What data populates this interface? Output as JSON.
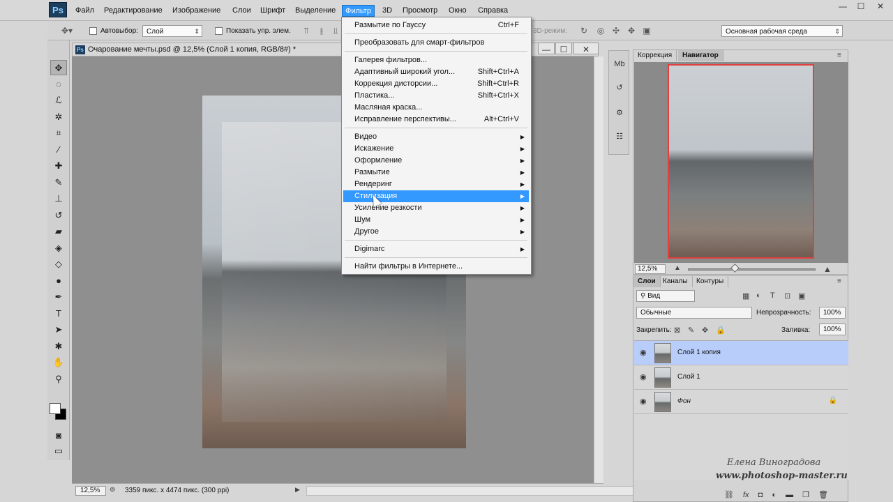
{
  "menubar": {
    "logo": "Ps",
    "items": [
      "Файл",
      "Редактирование",
      "Изображение",
      "Слои",
      "Шрифт",
      "Выделение",
      "Фильтр",
      "3D",
      "Просмотр",
      "Окно",
      "Справка"
    ],
    "active_index": 6,
    "window_controls": [
      "—",
      "☐",
      "✕"
    ]
  },
  "options": {
    "autoselect_label": "Автовыбор:",
    "autoselect_value": "Слой",
    "show_controls_label": "Показать упр. элем.",
    "mode3d_label": "3D-режим:",
    "workspace_value": "Основная рабочая среда"
  },
  "tools": [
    {
      "icon": "move-tool-icon",
      "glyph": "✥"
    },
    {
      "icon": "marquee-tool-icon",
      "glyph": "◌"
    },
    {
      "icon": "lasso-tool-icon",
      "glyph": "ℒ"
    },
    {
      "icon": "quick-select-tool-icon",
      "glyph": "✲"
    },
    {
      "icon": "crop-tool-icon",
      "glyph": "⌗"
    },
    {
      "icon": "eyedropper-tool-icon",
      "glyph": "⁄"
    },
    {
      "icon": "healing-brush-tool-icon",
      "glyph": "✚"
    },
    {
      "icon": "brush-tool-icon",
      "glyph": "✎"
    },
    {
      "icon": "clone-stamp-tool-icon",
      "glyph": "⊥"
    },
    {
      "icon": "history-brush-tool-icon",
      "glyph": "↺"
    },
    {
      "icon": "eraser-tool-icon",
      "glyph": "▰"
    },
    {
      "icon": "paint-bucket-tool-icon",
      "glyph": "◈"
    },
    {
      "icon": "blur-tool-icon",
      "glyph": "◇"
    },
    {
      "icon": "dodge-tool-icon",
      "glyph": "●"
    },
    {
      "icon": "pen-tool-icon",
      "glyph": "✒"
    },
    {
      "icon": "type-tool-icon",
      "glyph": "T"
    },
    {
      "icon": "path-select-tool-icon",
      "glyph": "➤"
    },
    {
      "icon": "shape-tool-icon",
      "glyph": "✱"
    },
    {
      "icon": "hand-tool-icon",
      "glyph": "✋"
    },
    {
      "icon": "zoom-tool-icon",
      "glyph": "⚲"
    }
  ],
  "document": {
    "title": "Очарование мечты.psd @ 12,5% (Слой 1 копия, RGB/8#) *",
    "controls": [
      "—",
      "☐",
      "✕"
    ],
    "status_zoom": "12,5%",
    "status_info": "3359 пикс. x 4474 пикс. (300 ppi)"
  },
  "filter_menu": {
    "items": [
      {
        "label": "Размытие по Гауссу",
        "shortcut": "Ctrl+F"
      },
      {
        "sep": true
      },
      {
        "label": "Преобразовать для смарт-фильтров"
      },
      {
        "sep": true
      },
      {
        "label": "Галерея фильтров..."
      },
      {
        "label": "Адаптивный широкий угол...",
        "shortcut": "Shift+Ctrl+A"
      },
      {
        "label": "Коррекция дисторсии...",
        "shortcut": "Shift+Ctrl+R"
      },
      {
        "label": "Пластика...",
        "shortcut": "Shift+Ctrl+X"
      },
      {
        "label": "Масляная краска..."
      },
      {
        "label": "Исправление перспективы...",
        "shortcut": "Alt+Ctrl+V"
      },
      {
        "sep": true
      },
      {
        "label": "Видео",
        "submenu": true
      },
      {
        "label": "Искажение",
        "submenu": true
      },
      {
        "label": "Оформление",
        "submenu": true
      },
      {
        "label": "Размытие",
        "submenu": true
      },
      {
        "label": "Рендеринг",
        "submenu": true
      },
      {
        "label": "Стилизация",
        "submenu": true,
        "highlighted": true
      },
      {
        "label": "Усиление резкости",
        "submenu": true
      },
      {
        "label": "Шум",
        "submenu": true
      },
      {
        "label": "Другое",
        "submenu": true
      },
      {
        "sep": true
      },
      {
        "label": "Digimarc",
        "submenu": true
      },
      {
        "sep": true
      },
      {
        "label": "Найти фильтры в Интернете..."
      }
    ]
  },
  "navigator": {
    "tabs": [
      "Коррекция",
      "Навигатор"
    ],
    "active_tab": 1,
    "zoom": "12,5%"
  },
  "layers": {
    "tabs": [
      "Слои",
      "Каналы",
      "Контуры"
    ],
    "filter_value": "Вид",
    "blend_mode": "Обычные",
    "opacity_label": "Непрозрачность:",
    "opacity_value": "100%",
    "lock_label": "Закрепить:",
    "fill_label": "Заливка:",
    "fill_value": "100%",
    "items": [
      {
        "name": "Слой 1 копия",
        "selected": true,
        "locked": false,
        "italic": false
      },
      {
        "name": "Слой 1",
        "selected": false,
        "locked": false,
        "italic": false
      },
      {
        "name": "Фон",
        "selected": false,
        "locked": true,
        "italic": true
      }
    ],
    "footer_icons": [
      "link-icon",
      "fx-icon",
      "mask-icon",
      "adjustment-icon",
      "folder-icon",
      "new-layer-icon",
      "trash-icon"
    ]
  },
  "watermark": {
    "author": "Елена Виноградова",
    "site": "www.photoshop-master.ru"
  }
}
